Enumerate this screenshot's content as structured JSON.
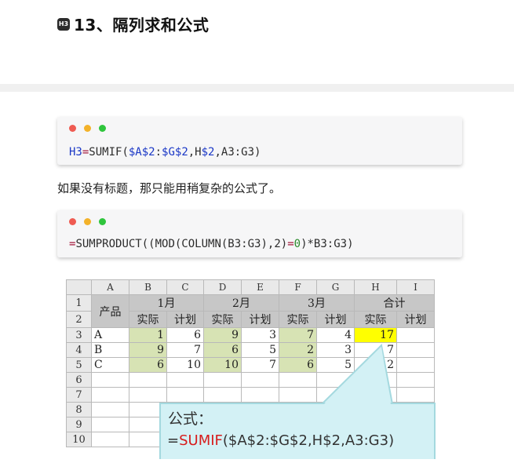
{
  "heading": {
    "badge": "H3",
    "title": "13、隔列求和公式"
  },
  "code1": {
    "window_dots": [
      "red",
      "yellow",
      "green"
    ],
    "parts": [
      {
        "t": "H3",
        "c": "kw"
      },
      {
        "t": "=",
        "c": "op"
      },
      {
        "t": "SUMIF(",
        "c": "fn"
      },
      {
        "t": "$A$2",
        "c": "kw"
      },
      {
        "t": ":",
        "c": "txt"
      },
      {
        "t": "$G$2",
        "c": "kw"
      },
      {
        "t": ",H",
        "c": "txt"
      },
      {
        "t": "$2",
        "c": "kw"
      },
      {
        "t": ",A3:G3)",
        "c": "txt"
      }
    ]
  },
  "paragraph": "如果没有标题，那只能用稍复杂的公式了。",
  "code2": {
    "window_dots": [
      "red",
      "yellow",
      "green"
    ],
    "parts": [
      {
        "t": "=",
        "c": "op"
      },
      {
        "t": "SUMPRODUCT((MOD(COLUMN(B3:G3),",
        "c": "fn"
      },
      {
        "t": "2",
        "c": "txt"
      },
      {
        "t": ")",
        "c": "txt"
      },
      {
        "t": "=",
        "c": "op"
      },
      {
        "t": "0",
        "c": "num"
      },
      {
        "t": ")*B3:G3)",
        "c": "txt"
      }
    ]
  },
  "spreadsheet": {
    "columns": [
      "A",
      "B",
      "C",
      "D",
      "E",
      "F",
      "G",
      "H",
      "I"
    ],
    "row_numbers": [
      "1",
      "2",
      "3",
      "4",
      "5",
      "6",
      "7",
      "8",
      "9",
      "10"
    ],
    "header_product": "产品",
    "month_headers": [
      "1月",
      "2月",
      "3月",
      "合计"
    ],
    "sub_headers": [
      "实际",
      "计划",
      "实际",
      "计划",
      "实际",
      "计划",
      "实际",
      "计划"
    ],
    "rows": [
      {
        "label": "A",
        "values": [
          "1",
          "6",
          "9",
          "3",
          "7",
          "4",
          "17",
          ""
        ]
      },
      {
        "label": "B",
        "values": [
          "9",
          "7",
          "6",
          "5",
          "2",
          "3",
          "7",
          ""
        ]
      },
      {
        "label": "C",
        "values": [
          "6",
          "10",
          "10",
          "7",
          "6",
          "5",
          "2",
          ""
        ]
      }
    ]
  },
  "callout": {
    "title": "公式：",
    "formula_prefix": "=",
    "formula_fn": "SUMIF",
    "formula_rest": "($A$2:$G$2,H$2,A3:G3)"
  }
}
